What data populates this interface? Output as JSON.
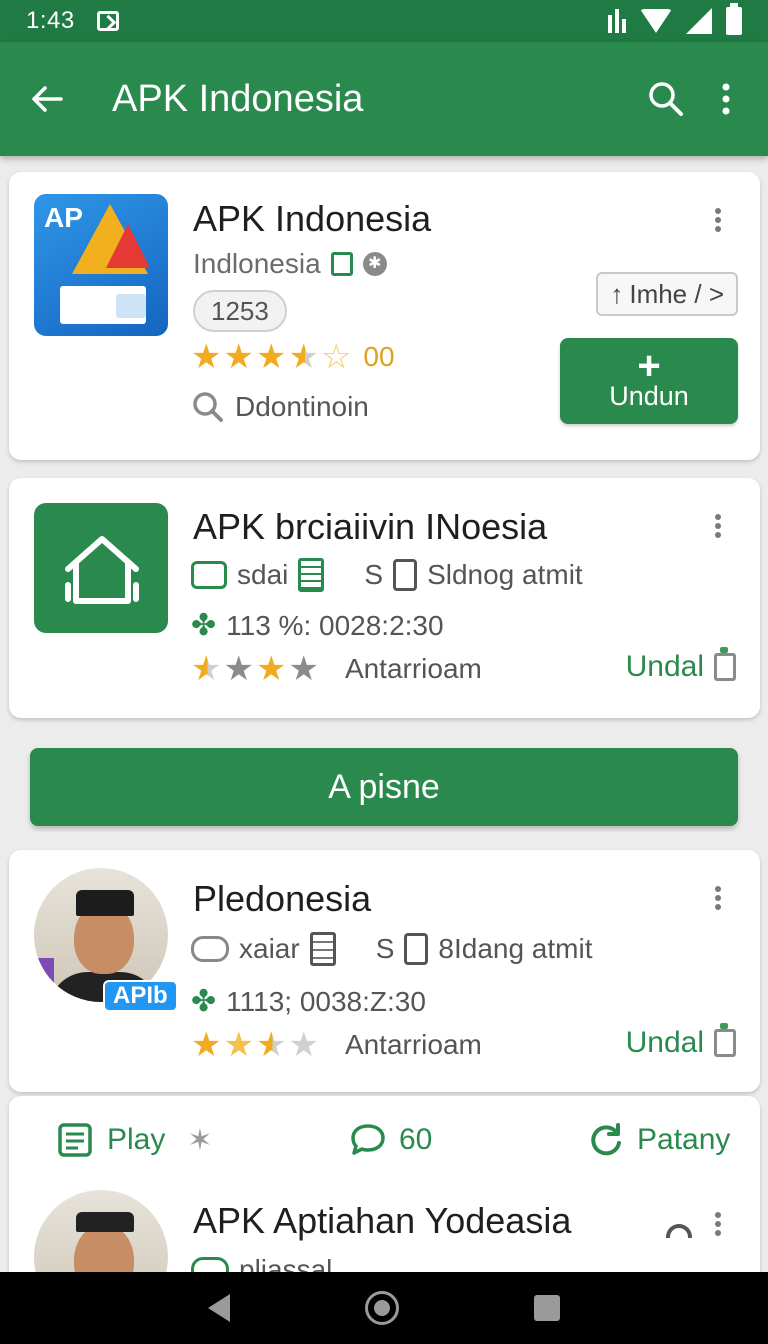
{
  "status_bar": {
    "time": "1:43"
  },
  "app_bar": {
    "title": "APK Indonesia"
  },
  "apps": [
    {
      "name": "APK Indonesia",
      "developer": "Indlonesia",
      "count": "1253",
      "rating_text": "00",
      "meta": "Ddontinoin",
      "small_button": "Imhe / >",
      "install_plus": "+",
      "install_label": "Undun",
      "icon_text": "AP"
    },
    {
      "name": "APK brciaiivin INoesia",
      "meta1": "sdai",
      "meta2_prefix": "S",
      "meta2": "Sldnog atmit",
      "stats": "113 %: 0028:2:30",
      "rating_label": "Antarrioam",
      "action": "Undal"
    },
    {
      "name": "Pledonesia",
      "meta1": "xaiar",
      "meta2_prefix": "S",
      "meta2": "8Idang atmit",
      "stats": "1113; 0038:Z:30",
      "rating_label": "Antarrioam",
      "action": "Undal",
      "badge": "APIb"
    },
    {
      "name": "APK Aptiahan Yodeasia",
      "meta1": "pliassal"
    }
  ],
  "primary_button": "A pisne",
  "tabs": [
    {
      "label": "Play",
      "icon": "list-icon"
    },
    {
      "label": "60",
      "icon": "chat-icon"
    },
    {
      "label": "Patany",
      "icon": "refresh-icon"
    }
  ],
  "colors": {
    "primary": "#2a8a4e",
    "status_bar": "#1f7a43",
    "star": "#f2ab20"
  }
}
